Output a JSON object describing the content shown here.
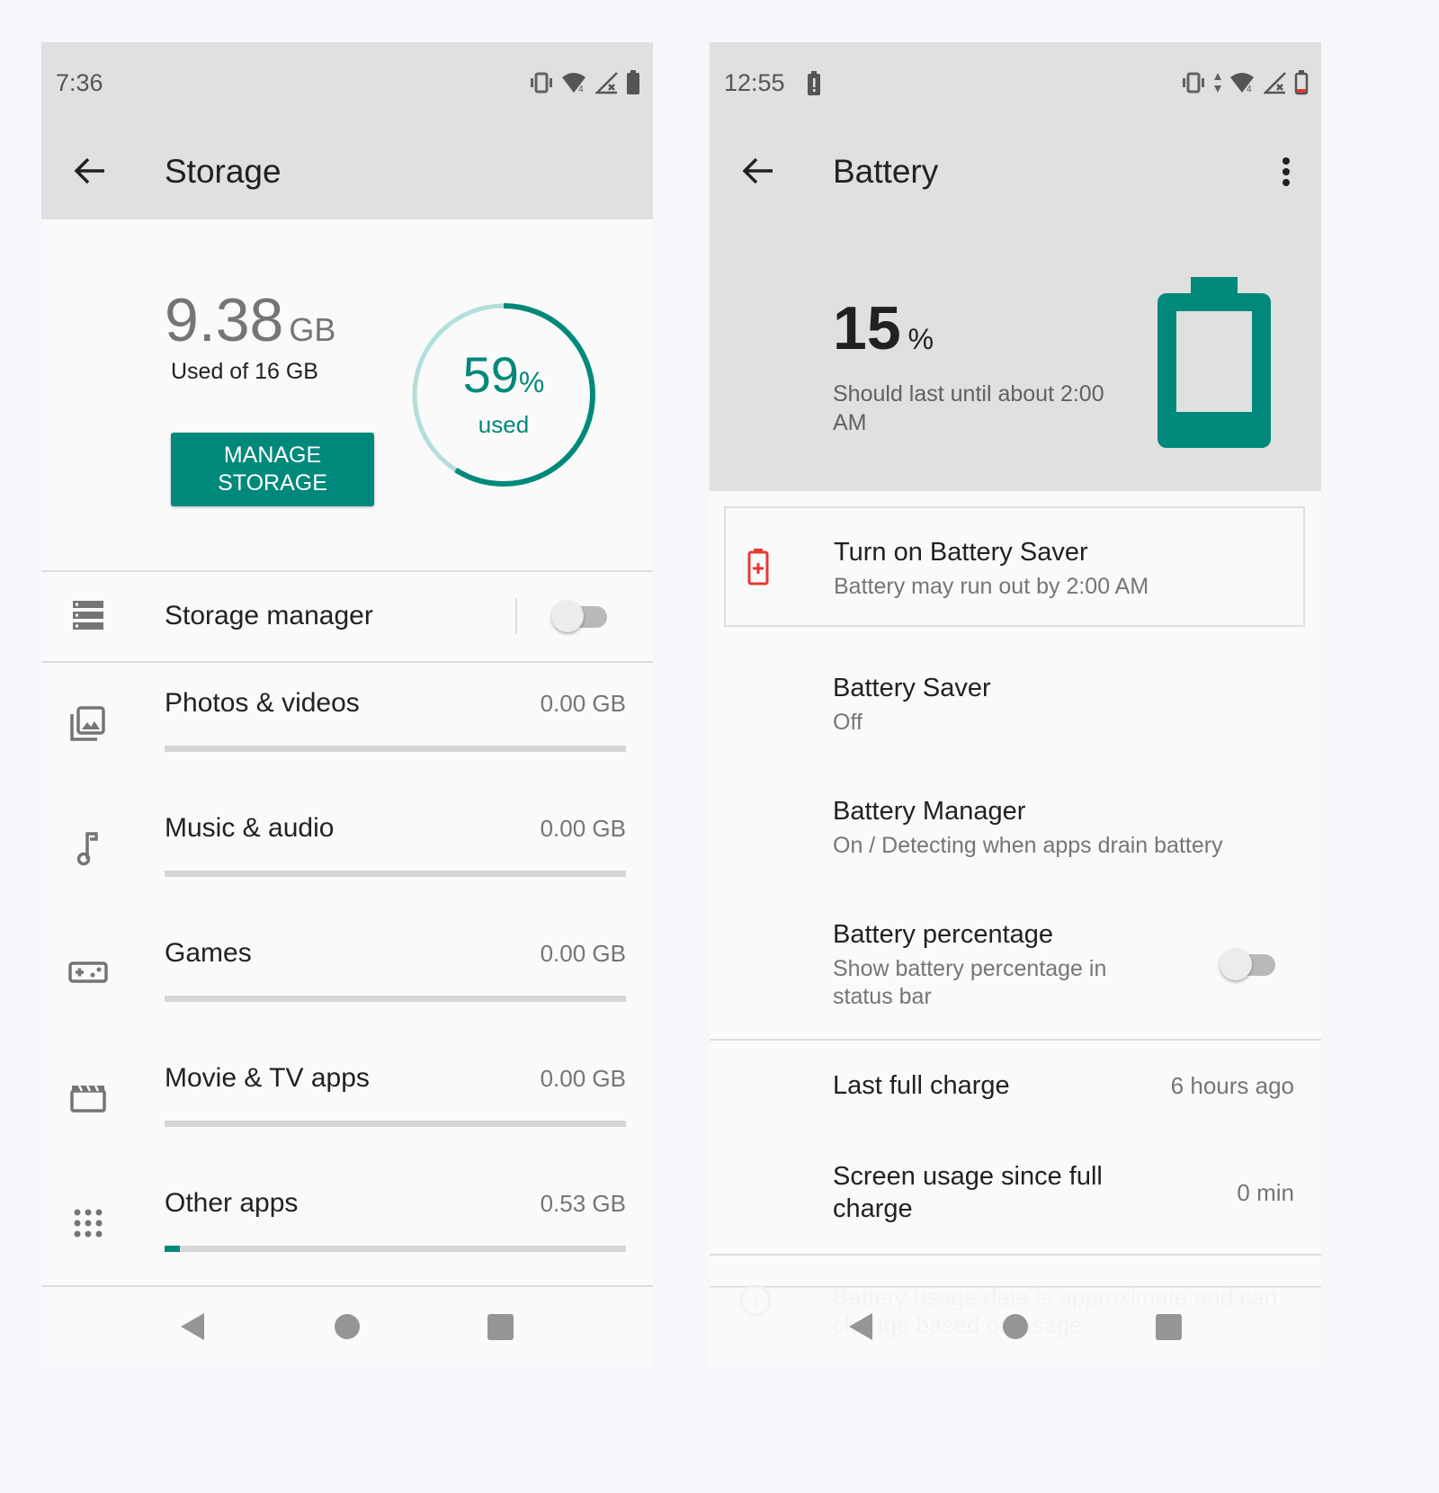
{
  "storage_screen": {
    "status_bar": {
      "time": "7:36",
      "icons": [
        "vibrate-icon",
        "wifi-icon",
        "cell-signal-no-service-icon",
        "battery-full-icon"
      ]
    },
    "app_bar": {
      "title": "Storage"
    },
    "summary": {
      "used_value": "9.38",
      "used_unit": "GB",
      "used_of": "Used of 16 GB",
      "percent_used": 59,
      "percent_value": "59",
      "percent_sign": "%",
      "percent_caption": "used",
      "manage_button_line1": "MANAGE",
      "manage_button_line2": "STORAGE"
    },
    "storage_manager": {
      "label": "Storage manager",
      "enabled": false
    },
    "categories": [
      {
        "label": "Photos & videos",
        "value": "0.00 GB",
        "fraction": 0.0,
        "icon": "photo-library-icon"
      },
      {
        "label": "Music & audio",
        "value": "0.00 GB",
        "fraction": 0.0,
        "icon": "music-note-icon"
      },
      {
        "label": "Games",
        "value": "0.00 GB",
        "fraction": 0.0,
        "icon": "gamepad-icon"
      },
      {
        "label": "Movie & TV apps",
        "value": "0.00 GB",
        "fraction": 0.0,
        "icon": "movie-icon"
      },
      {
        "label": "Other apps",
        "value": "0.53 GB",
        "fraction": 0.033,
        "icon": "apps-grid-icon"
      }
    ]
  },
  "battery_screen": {
    "status_bar": {
      "time": "12:55",
      "icons": [
        "battery-alert-icon",
        "vibrate-icon",
        "data-activity-icon",
        "wifi-icon",
        "cell-signal-no-service-icon",
        "battery-low-icon"
      ]
    },
    "app_bar": {
      "title": "Battery"
    },
    "header": {
      "percent": "15",
      "percent_sign": "%",
      "level_fraction": 0.15,
      "estimate": "Should last until about 2:00 AM"
    },
    "saver_suggestion": {
      "title": "Turn on Battery Saver",
      "subtitle": "Battery may run out by 2:00 AM"
    },
    "items": [
      {
        "title": "Battery Saver",
        "subtitle": "Off"
      },
      {
        "title": "Battery Manager",
        "subtitle": "On / Detecting when apps drain battery"
      },
      {
        "title": "Battery percentage",
        "subtitle": "Show battery percentage in status bar",
        "toggle": false
      }
    ],
    "stats": [
      {
        "label": "Last full charge",
        "value": "6 hours ago"
      },
      {
        "label": "Screen usage since full charge",
        "value": "0 min"
      }
    ],
    "footnote": "Battery usage data is approximate and can change based on usage"
  },
  "colors": {
    "accent": "#00897b",
    "accent_light": "#b2dfdb",
    "alert_red": "#e53935",
    "header_grey": "#e0e0e0"
  }
}
